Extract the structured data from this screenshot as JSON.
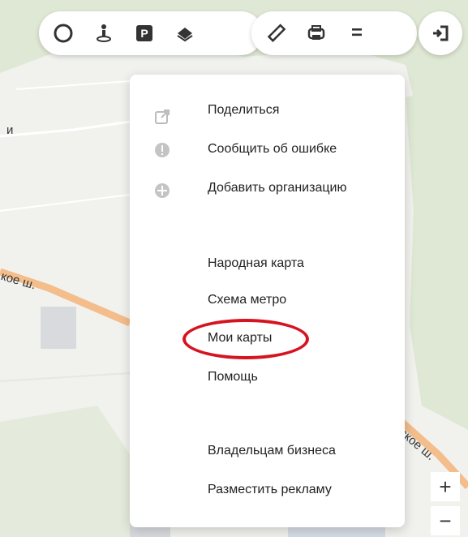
{
  "toolbar": {
    "group1": [
      "traffic-icon",
      "panorama-icon",
      "parking-icon",
      "layers-icon"
    ],
    "group2": [
      "ruler-icon",
      "print-icon",
      "menu-icon"
    ],
    "parking_label": "P",
    "menu_label": "="
  },
  "menu": {
    "top_items": [
      {
        "label": "Поделиться",
        "icon": "share-icon"
      },
      {
        "label": "Сообщить об ошибке",
        "icon": "report-error-icon"
      },
      {
        "label": "Добавить организацию",
        "icon": "add-organization-icon"
      }
    ],
    "middle_items": [
      {
        "label": "Народная карта"
      },
      {
        "label": "Схема метро"
      },
      {
        "label": "Мои карты"
      },
      {
        "label": "Помощь"
      }
    ],
    "bottom_items": [
      {
        "label": "Владельцам бизнеса"
      },
      {
        "label": "Разместить рекламу"
      }
    ]
  },
  "map_labels": {
    "left_letter": "и",
    "road_left": "кое ш.",
    "road_right": "ское ш."
  },
  "zoom": {
    "in_label": "+",
    "out_label": "−"
  },
  "colors": {
    "highlight": "#d6141f",
    "road": "#f4bd8c",
    "forest": "#dfe8d4"
  }
}
